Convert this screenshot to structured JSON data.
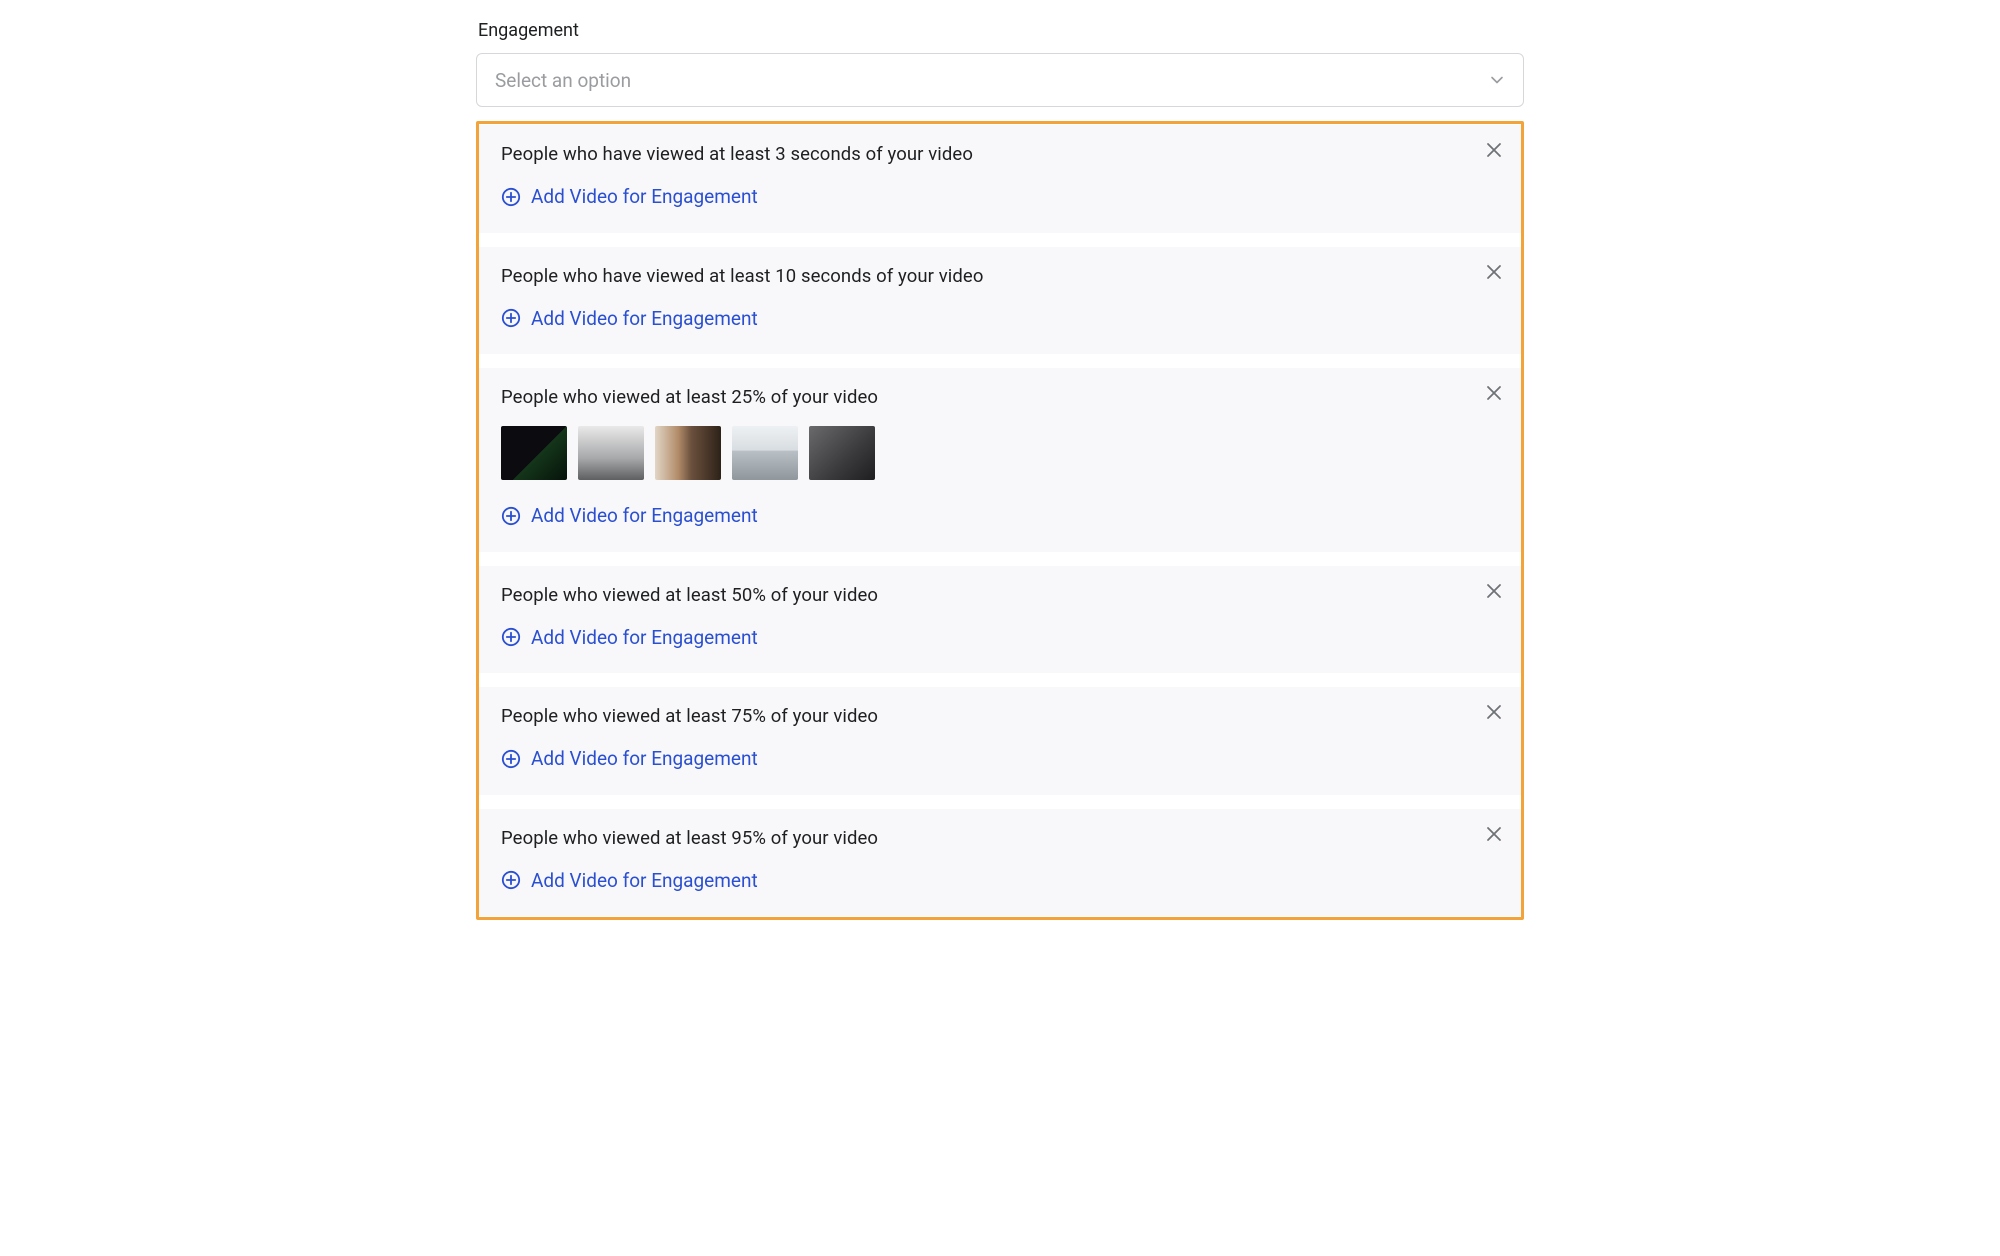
{
  "section_label": "Engagement",
  "select": {
    "placeholder": "Select an option"
  },
  "add_label": "Add Video for Engagement",
  "cards": [
    {
      "title": "People who have viewed at least 3 seconds of your video",
      "has_thumbs": false
    },
    {
      "title": "People who have viewed at least 10 seconds of your video",
      "has_thumbs": false
    },
    {
      "title": "People who viewed at least 25% of your video",
      "has_thumbs": true
    },
    {
      "title": "People who viewed at least 50% of your video",
      "has_thumbs": false
    },
    {
      "title": "People who viewed at least 75% of your video",
      "has_thumbs": false
    },
    {
      "title": "People who viewed at least 95% of your video",
      "has_thumbs": false
    }
  ],
  "colors": {
    "accent": "#2a4fd1",
    "highlight": "#f2a43a"
  }
}
